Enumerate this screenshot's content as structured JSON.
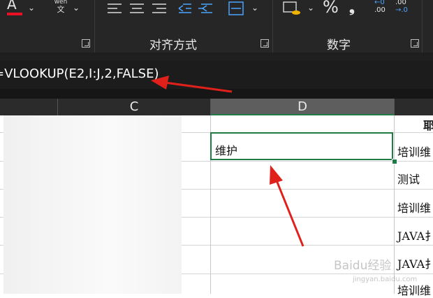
{
  "ribbon": {
    "font_color_glyph": "A",
    "phonetic_top": "wén",
    "phonetic_bottom": "文",
    "alignment_group_label": "对齐方式",
    "number_group_label": "数字",
    "percent_glyph": "%",
    "comma_glyph": "❟",
    "increase_decimal_top": "←0",
    "increase_decimal_bottom": ".00",
    "decrease_decimal_top": ".00",
    "decrease_decimal_bottom": "→.0",
    "font_color_bar_color": "#e81123"
  },
  "formula_bar": {
    "formula": "=VLOOKUP(E2,I:J,2,FALSE)"
  },
  "columns": {
    "c": "C",
    "d": "D"
  },
  "cells": {
    "d2": "维护",
    "e_col": [
      "培训维",
      "测试",
      "培训维",
      "JAVA扌",
      "JAVA扌",
      "培训维"
    ],
    "e1_partial": "耶"
  },
  "watermark": "Baidu经验",
  "watermark_sub": "jingyan.baidu.com",
  "arrow_color": "#e0201b"
}
